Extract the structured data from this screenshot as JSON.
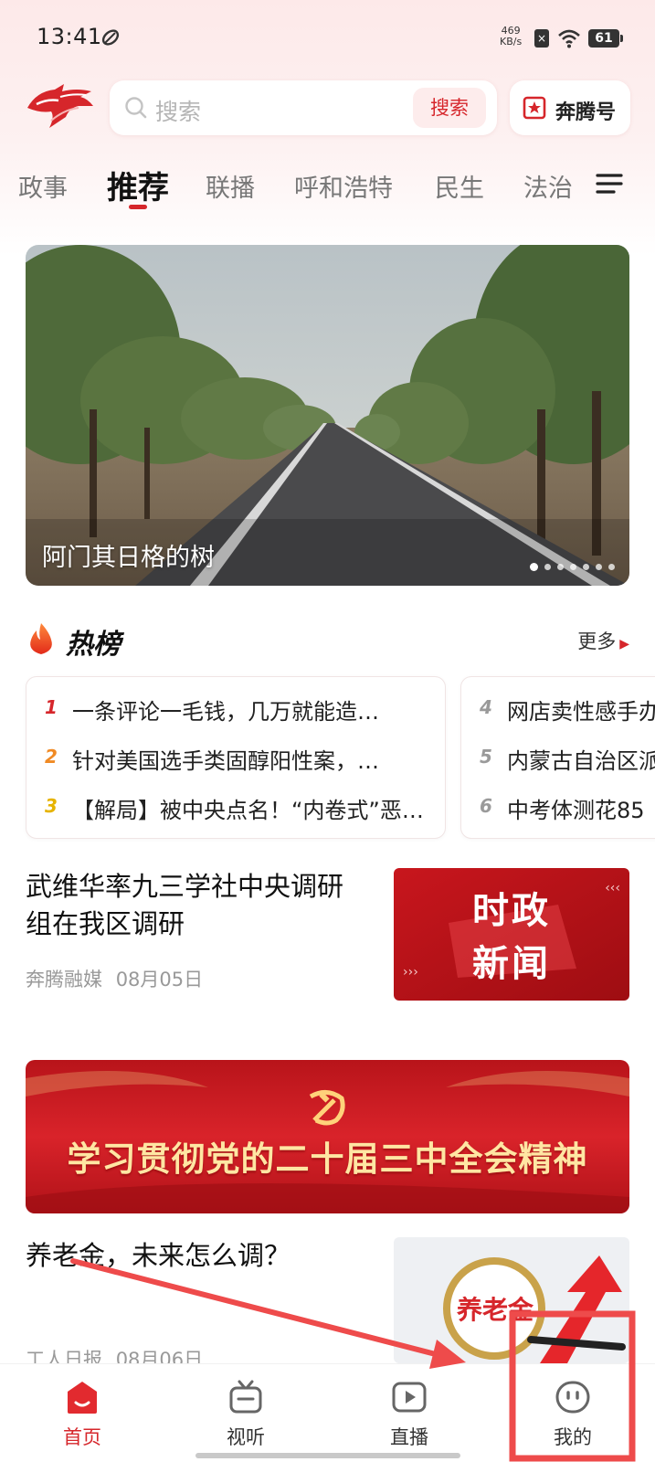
{
  "status_bar": {
    "time": "13:41",
    "net_speed_value": "469",
    "net_speed_unit": "KB/s",
    "battery": "61"
  },
  "header": {
    "search_placeholder": "搜索",
    "search_button": "搜索",
    "benteng_label": "奔腾号"
  },
  "tabs": [
    "政事",
    "推荐",
    "联播",
    "呼和浩特",
    "民生",
    "法治"
  ],
  "active_tab": "推荐",
  "banner": {
    "caption": "阿门其日格的树",
    "slide_count": 7,
    "active_slide": 1
  },
  "hot": {
    "title": "热榜",
    "more": "更多",
    "items": [
      {
        "rank": "1",
        "text": "一条评论一毛钱，几万就能造…"
      },
      {
        "rank": "2",
        "text": "针对美国选手类固醇阳性案，…"
      },
      {
        "rank": "3",
        "text": "【解局】被中央点名！“内卷式”恶…"
      },
      {
        "rank": "4",
        "text": "网店卖性感手办"
      },
      {
        "rank": "5",
        "text": "内蒙古自治区派"
      },
      {
        "rank": "6",
        "text": "中考体测花85"
      }
    ]
  },
  "articles": [
    {
      "title": "武维华率九三学社中央调研组在我区调研",
      "source": "奔腾融媒",
      "date": "08月05日",
      "thumb_line1": "时政",
      "thumb_line2": "新闻"
    },
    {
      "title": "养老金，未来怎么调？",
      "source": "工人日报",
      "date": "08月06日",
      "thumb_text": "养老金"
    }
  ],
  "party_banner": {
    "text": "学习贯彻党的二十届三中全会精神"
  },
  "bottom_nav": [
    {
      "label": "首页",
      "icon": "home-icon",
      "active": true
    },
    {
      "label": "视听",
      "icon": "tv-icon",
      "active": false
    },
    {
      "label": "直播",
      "icon": "live-play-icon",
      "active": false
    },
    {
      "label": "我的",
      "icon": "profile-face-icon",
      "active": false
    }
  ],
  "colors": {
    "brand_red": "#d6262b",
    "annotation_red": "#ee4b4b"
  }
}
